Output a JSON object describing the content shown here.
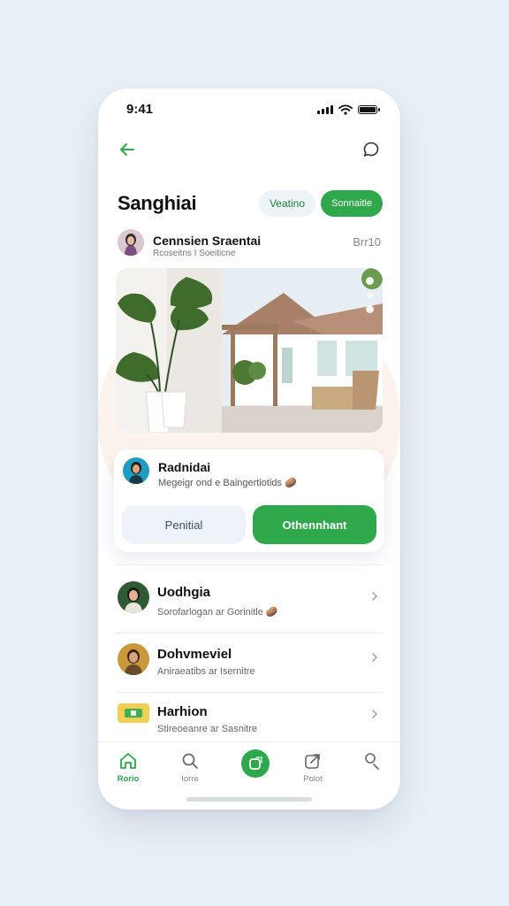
{
  "status_bar": {
    "time": "9:41"
  },
  "header": {
    "title": "Sanghiai",
    "pill_outline": "Veatino",
    "pill_green": "Sonnaitle"
  },
  "post": {
    "author": "Cennsien Sraentai",
    "subtitle": "Rcoseitns I Soeiticne",
    "time": "Brr10"
  },
  "card": {
    "name": "Radnidai",
    "subtitle": "Megeigr ond e Baingertiotids",
    "emoji": "🥔",
    "button_secondary": "Penitial",
    "button_primary": "Othennhant"
  },
  "list": [
    {
      "title": "Uodhgia",
      "subtitle": "Sorofarlogan ar Gorinitle",
      "emoji": "🥔"
    },
    {
      "title": "Dohvmeviel",
      "subtitle": "Aniraeatibs ar Isernitre",
      "emoji": ""
    },
    {
      "title": "Harhion",
      "subtitle": "Stireoeanre ar Sasnitre",
      "emoji": ""
    }
  ],
  "tabbar": {
    "tabs": [
      {
        "label": "Rorio",
        "icon": "home-icon"
      },
      {
        "label": "Iorre",
        "icon": "search-icon"
      },
      {
        "label": "",
        "icon": "compose-icon"
      },
      {
        "label": "Polot",
        "icon": "share-icon"
      },
      {
        "label": "",
        "icon": "profile-icon"
      }
    ]
  },
  "colors": {
    "accent": "#2ea84a",
    "background": "#eaf0f7"
  }
}
